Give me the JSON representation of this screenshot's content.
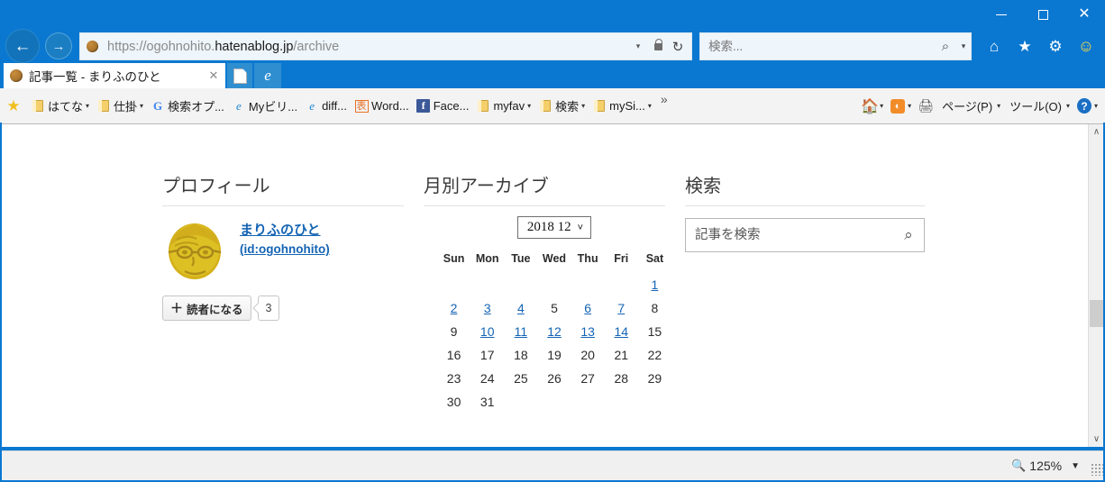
{
  "window": {
    "minimize_label": "–",
    "maximize_label": "☐",
    "close_label": "✕"
  },
  "browser": {
    "back_label": "←",
    "forward_label": "→",
    "address": {
      "url_prefix": "https://ogohnohito.",
      "url_domain": "hatenablog.jp",
      "url_suffix": "/archive",
      "full_url": "https://ogohnohito.hatenablog.jp/archive",
      "dropdown_label": "▾",
      "lock_icon": "lock-icon",
      "refresh_label": "↻"
    },
    "search": {
      "placeholder": "検索...",
      "value": "",
      "magnifier_label": "⌕",
      "caret_label": "▾"
    },
    "toolbar_icons": [
      {
        "name": "home-icon",
        "glyph": "⌂"
      },
      {
        "name": "favorites-star-icon",
        "glyph": "★"
      },
      {
        "name": "settings-gear-icon",
        "glyph": "⚙"
      },
      {
        "name": "smiley-feedback-icon",
        "glyph": "☺"
      }
    ],
    "tab": {
      "title": "記事一覧 - まりふのひと",
      "close_label": "✕",
      "new_tab_label": "",
      "edge_label": "e"
    },
    "favorites": {
      "star_label": "☆",
      "items": [
        {
          "label": "はてな",
          "icon": "folder-icon",
          "caret": "▾"
        },
        {
          "label": "仕掛",
          "icon": "folder-icon",
          "caret": "▾"
        },
        {
          "label": "検索オプ...",
          "icon": "google-icon",
          "caret": ""
        },
        {
          "label": "Myビリ...",
          "icon": "ie-document-icon",
          "caret": ""
        },
        {
          "label": "diff...",
          "icon": "ie-document-icon",
          "caret": ""
        },
        {
          "label": "Word...",
          "icon": "ja-ime-icon",
          "caret": ""
        },
        {
          "label": "Face...",
          "icon": "facebook-icon",
          "caret": ""
        },
        {
          "label": "myfav",
          "icon": "folder-icon",
          "caret": "▾"
        },
        {
          "label": "検索",
          "icon": "folder-icon",
          "caret": "▾"
        },
        {
          "label": "mySi...",
          "icon": "folder-icon",
          "caret": "▾"
        }
      ],
      "overflow_label": "»",
      "right_items": [
        {
          "label": "",
          "icon": "home-icon",
          "caret": "▾"
        },
        {
          "label": "",
          "icon": "rss-feed-icon",
          "caret": "▾"
        },
        {
          "label": "",
          "icon": "print-icon",
          "caret": ""
        },
        {
          "label": "ページ(P)",
          "icon": "",
          "caret": "▾"
        },
        {
          "label": "ツール(O)",
          "icon": "",
          "caret": "▾"
        },
        {
          "label": "",
          "icon": "help-icon",
          "caret": "▾"
        }
      ]
    },
    "status": {
      "zoom_label": "125%",
      "zoom_icon": "zoom-magnifier-icon",
      "zoom_caret": "▼"
    },
    "scrollbar": {
      "up_label": "∧",
      "down_label": "∨"
    }
  },
  "page": {
    "profile": {
      "title": "プロフィール",
      "avatar_alt": "marifu-no-hito-avatar",
      "name": "まりふのひと",
      "id": "(id:ogohnohito)",
      "subscribe_label": "読者になる",
      "subscribe_plus": "＋",
      "subscriber_count": "3"
    },
    "archive": {
      "title": "月別アーカイブ",
      "selected_month": "2018 12",
      "select_caret": "˅",
      "weekday_headers": [
        "Sun",
        "Mon",
        "Tue",
        "Wed",
        "Thu",
        "Fri",
        "Sat"
      ],
      "weeks": [
        [
          {
            "day": "",
            "link": false
          },
          {
            "day": "",
            "link": false
          },
          {
            "day": "",
            "link": false
          },
          {
            "day": "",
            "link": false
          },
          {
            "day": "",
            "link": false
          },
          {
            "day": "",
            "link": false
          },
          {
            "day": "1",
            "link": true
          }
        ],
        [
          {
            "day": "2",
            "link": true
          },
          {
            "day": "3",
            "link": true
          },
          {
            "day": "4",
            "link": true
          },
          {
            "day": "5",
            "link": false
          },
          {
            "day": "6",
            "link": true
          },
          {
            "day": "7",
            "link": true
          },
          {
            "day": "8",
            "link": false
          }
        ],
        [
          {
            "day": "9",
            "link": false
          },
          {
            "day": "10",
            "link": true
          },
          {
            "day": "11",
            "link": true
          },
          {
            "day": "12",
            "link": true
          },
          {
            "day": "13",
            "link": true
          },
          {
            "day": "14",
            "link": true
          },
          {
            "day": "15",
            "link": false
          }
        ],
        [
          {
            "day": "16",
            "link": false
          },
          {
            "day": "17",
            "link": false
          },
          {
            "day": "18",
            "link": false
          },
          {
            "day": "19",
            "link": false
          },
          {
            "day": "20",
            "link": false
          },
          {
            "day": "21",
            "link": false
          },
          {
            "day": "22",
            "link": false
          }
        ],
        [
          {
            "day": "23",
            "link": false
          },
          {
            "day": "24",
            "link": false
          },
          {
            "day": "25",
            "link": false
          },
          {
            "day": "26",
            "link": false
          },
          {
            "day": "27",
            "link": false
          },
          {
            "day": "28",
            "link": false
          },
          {
            "day": "29",
            "link": false
          }
        ],
        [
          {
            "day": "30",
            "link": false
          },
          {
            "day": "31",
            "link": false
          },
          {
            "day": "",
            "link": false
          },
          {
            "day": "",
            "link": false
          },
          {
            "day": "",
            "link": false
          },
          {
            "day": "",
            "link": false
          },
          {
            "day": "",
            "link": false
          }
        ]
      ]
    },
    "search": {
      "title": "検索",
      "placeholder": "記事を検索",
      "value": "",
      "button_icon": "⌕"
    }
  },
  "colors": {
    "chrome_blue": "#0a78d1",
    "link_blue": "#1464b4",
    "page_bg": "#ffffff",
    "rule_gray": "#e2e2e2"
  }
}
